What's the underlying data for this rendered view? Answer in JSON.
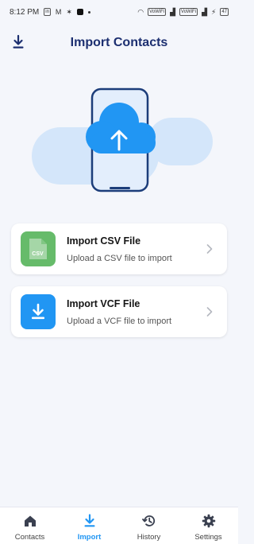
{
  "status_bar": {
    "time": "8:12 PM",
    "battery": "47"
  },
  "header": {
    "title": "Import Contacts",
    "icon": "download-icon"
  },
  "illustration": {
    "icon": "cloud-upload-phone-icon"
  },
  "options": [
    {
      "title": "Import CSV File",
      "subtitle": "Upload a CSV file to import",
      "icon_label": "CSV",
      "icon": "csv-file-icon",
      "color": "#66bb6a"
    },
    {
      "title": "Import VCF File",
      "subtitle": "Upload a VCF file to import",
      "icon": "download-icon",
      "color": "#2196f3"
    }
  ],
  "bottom_nav": {
    "items": [
      {
        "label": "Contacts",
        "icon": "home-icon",
        "active": false
      },
      {
        "label": "Import",
        "icon": "download-icon",
        "active": true
      },
      {
        "label": "History",
        "icon": "history-icon",
        "active": false
      },
      {
        "label": "Settings",
        "icon": "gear-icon",
        "active": false
      }
    ]
  },
  "colors": {
    "accent": "#2196f3",
    "title": "#1c2f70",
    "background": "#f4f6fb",
    "csv_green": "#66bb6a"
  }
}
